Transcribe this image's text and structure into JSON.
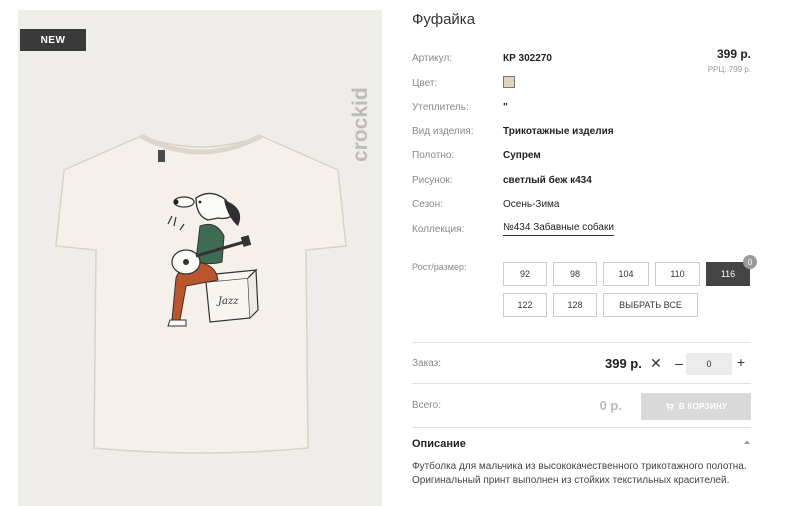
{
  "badge": "NEW",
  "brand": "crockid",
  "product": {
    "title": "Фуфайка",
    "price": "399 р.",
    "rrp": "РРЦ: 799 р."
  },
  "attributes": [
    {
      "label": "Артикул:",
      "value": "КР 302270"
    },
    {
      "label": "Цвет:",
      "value": ""
    },
    {
      "label": "Утеплитель:",
      "value": "\""
    },
    {
      "label": "Вид изделия:",
      "value": "Трикотажные изделия"
    },
    {
      "label": "Полотно:",
      "value": "Супрем"
    },
    {
      "label": "Рисунок:",
      "value": "светлый беж к434"
    },
    {
      "label": "Сезон:",
      "value": "Осень-Зима"
    },
    {
      "label": "Коллекция:",
      "value": "№434 Забавные собаки"
    }
  ],
  "colors": {
    "swatch": "#e0d6c0",
    "active_size": "#444444"
  },
  "sizes": {
    "label": "Рост/размер:",
    "options": [
      "92",
      "98",
      "104",
      "110",
      "116",
      "122",
      "128"
    ],
    "selected": "116",
    "select_all": "ВЫБРАТЬ ВСЕ",
    "selected_count": "0"
  },
  "order": {
    "label": "Заказ:",
    "price": "399 р.",
    "times": "✕",
    "minus": "–",
    "quantity": "0",
    "plus": "+"
  },
  "total": {
    "label": "Всего:",
    "value": "0 р.",
    "cart_button": "В КОРЗИНУ"
  },
  "description": {
    "title": "Описание",
    "text": "Футболка для мальчика из высококачественного трикотажного полотна. Оригинальный принт выполнен из стойких текстильных красителей."
  },
  "icons": [
    "cart-icon",
    "chevron-up-icon",
    "brand-logo"
  ],
  "print_text": "Jazz"
}
